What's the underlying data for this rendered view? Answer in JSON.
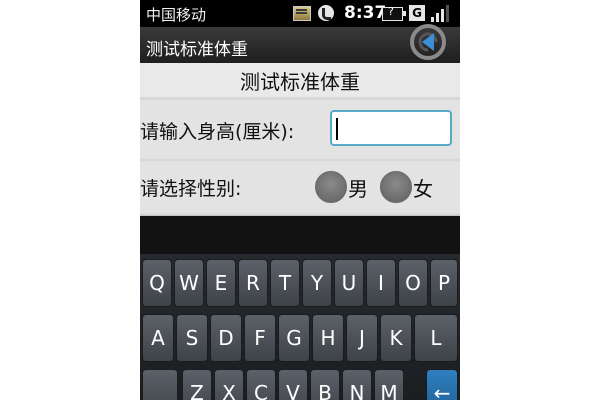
{
  "status_bar": {
    "carrier": "中国移动",
    "time": "8:37",
    "icons": [
      "sd-card-icon",
      "missed-call-icon",
      "battery-icon",
      "g-network-icon",
      "signal-icon"
    ],
    "network_label": "G"
  },
  "title_bar": {
    "title": "测试标准体重",
    "back_icon": "back-arrow-icon"
  },
  "form": {
    "header": "测试标准体重",
    "height_label": "请输入身高(厘米):",
    "height_value": "",
    "gender_label": "请选择性别:",
    "gender_options": [
      {
        "label": "男",
        "selected": false
      },
      {
        "label": "女",
        "selected": false
      }
    ]
  },
  "keyboard": {
    "row1": [
      "Q",
      "W",
      "E",
      "R",
      "T",
      "Y",
      "U",
      "I",
      "O",
      "P"
    ],
    "row2": [
      "A",
      "S",
      "D",
      "F",
      "G",
      "H",
      "J",
      "K",
      "L"
    ],
    "row3": [
      "",
      "Z",
      "X",
      "C",
      "V",
      "B",
      "N",
      "M",
      "←"
    ]
  },
  "colors": {
    "accent": "#58a8c8",
    "enter_key": "#2f7fbf",
    "key_bg": "#4d5258"
  }
}
